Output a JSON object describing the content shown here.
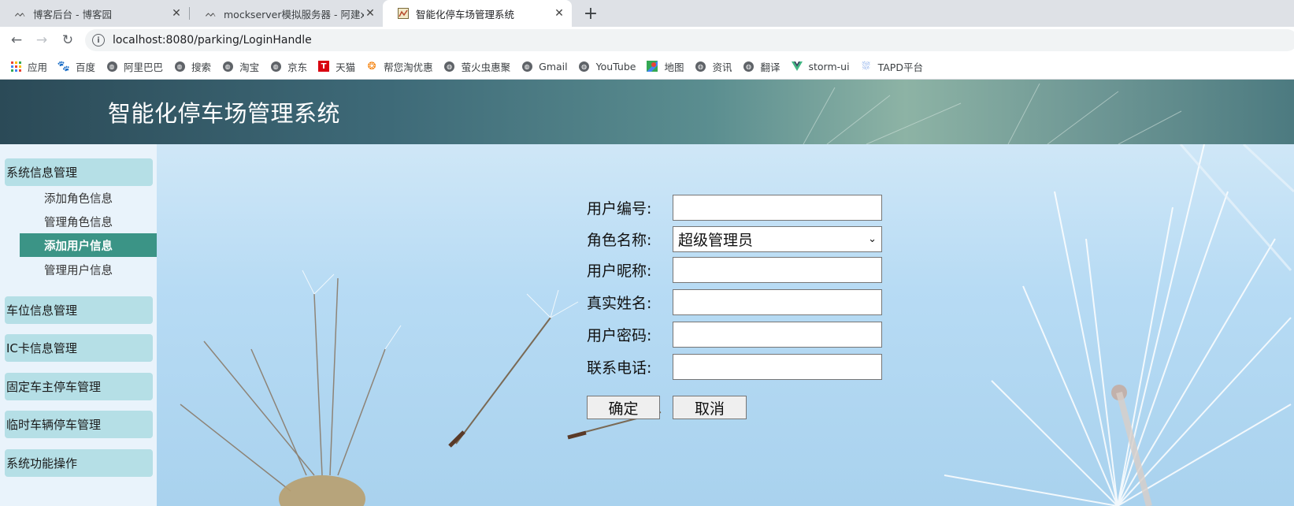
{
  "browser": {
    "tabs": [
      {
        "title": "博客后台 - 博客园",
        "active": false
      },
      {
        "title": "mockserver模拟服务器 - 阿建xj",
        "active": false
      },
      {
        "title": "智能化停车场管理系统",
        "active": true
      }
    ],
    "url": "localhost:8080/parking/LoginHandle",
    "bookmarks": [
      {
        "label": "应用",
        "icon": "apps-icon"
      },
      {
        "label": "百度",
        "icon": "baidu-icon"
      },
      {
        "label": "阿里巴巴",
        "icon": "globe-icon"
      },
      {
        "label": "搜索",
        "icon": "globe-icon"
      },
      {
        "label": "淘宝",
        "icon": "globe-icon"
      },
      {
        "label": "京东",
        "icon": "globe-icon"
      },
      {
        "label": "天猫",
        "icon": "tmall-icon"
      },
      {
        "label": "帮您淘优惠",
        "icon": "swirl-icon"
      },
      {
        "label": "萤火虫惠聚",
        "icon": "globe-icon"
      },
      {
        "label": "Gmail",
        "icon": "globe-icon"
      },
      {
        "label": "YouTube",
        "icon": "globe-icon"
      },
      {
        "label": "地图",
        "icon": "maps-icon"
      },
      {
        "label": "资讯",
        "icon": "globe-icon"
      },
      {
        "label": "翻译",
        "icon": "globe-icon"
      },
      {
        "label": "storm-ui",
        "icon": "vue-icon"
      },
      {
        "label": "TAPD平台",
        "icon": "tapd-icon"
      }
    ]
  },
  "app": {
    "title": "智能化停车场管理系统"
  },
  "sidebar": {
    "groups": [
      {
        "label": "系统信息管理"
      },
      {
        "label": "车位信息管理"
      },
      {
        "label": "IC卡信息管理"
      },
      {
        "label": "固定车主停车管理"
      },
      {
        "label": "临时车辆停车管理"
      },
      {
        "label": "系统功能操作"
      }
    ],
    "subitems": [
      {
        "label": "添加角色信息",
        "active": false
      },
      {
        "label": "管理角色信息",
        "active": false
      },
      {
        "label": "添加用户信息",
        "active": true
      },
      {
        "label": "管理用户信息",
        "active": false
      }
    ]
  },
  "form": {
    "user_id_label": "用户编号:",
    "user_id_value": "",
    "role_label": "角色名称:",
    "role_value": "超级管理员",
    "nickname_label": "用户昵称:",
    "nickname_value": "",
    "realname_label": "真实姓名:",
    "realname_value": "",
    "password_label": "用户密码:",
    "password_value": "",
    "phone_label": "联系电话:",
    "phone_value": "",
    "confirm_label": "确定",
    "cancel_label": "取消"
  },
  "colors": {
    "active_menu": "#3b9486",
    "menu_head": "#b5dfe6"
  }
}
